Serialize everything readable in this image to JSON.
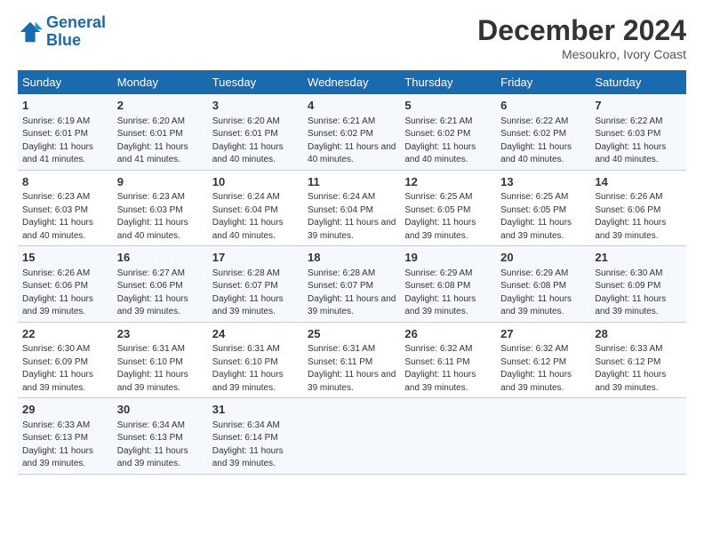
{
  "logo": {
    "line1": "General",
    "line2": "Blue"
  },
  "title": "December 2024",
  "subtitle": "Mesoukro, Ivory Coast",
  "days_of_week": [
    "Sunday",
    "Monday",
    "Tuesday",
    "Wednesday",
    "Thursday",
    "Friday",
    "Saturday"
  ],
  "weeks": [
    [
      {
        "num": "1",
        "rise": "6:19 AM",
        "set": "6:01 PM",
        "daylight": "11 hours and 41 minutes."
      },
      {
        "num": "2",
        "rise": "6:20 AM",
        "set": "6:01 PM",
        "daylight": "11 hours and 41 minutes."
      },
      {
        "num": "3",
        "rise": "6:20 AM",
        "set": "6:01 PM",
        "daylight": "11 hours and 40 minutes."
      },
      {
        "num": "4",
        "rise": "6:21 AM",
        "set": "6:02 PM",
        "daylight": "11 hours and 40 minutes."
      },
      {
        "num": "5",
        "rise": "6:21 AM",
        "set": "6:02 PM",
        "daylight": "11 hours and 40 minutes."
      },
      {
        "num": "6",
        "rise": "6:22 AM",
        "set": "6:02 PM",
        "daylight": "11 hours and 40 minutes."
      },
      {
        "num": "7",
        "rise": "6:22 AM",
        "set": "6:03 PM",
        "daylight": "11 hours and 40 minutes."
      }
    ],
    [
      {
        "num": "8",
        "rise": "6:23 AM",
        "set": "6:03 PM",
        "daylight": "11 hours and 40 minutes."
      },
      {
        "num": "9",
        "rise": "6:23 AM",
        "set": "6:03 PM",
        "daylight": "11 hours and 40 minutes."
      },
      {
        "num": "10",
        "rise": "6:24 AM",
        "set": "6:04 PM",
        "daylight": "11 hours and 40 minutes."
      },
      {
        "num": "11",
        "rise": "6:24 AM",
        "set": "6:04 PM",
        "daylight": "11 hours and 39 minutes."
      },
      {
        "num": "12",
        "rise": "6:25 AM",
        "set": "6:05 PM",
        "daylight": "11 hours and 39 minutes."
      },
      {
        "num": "13",
        "rise": "6:25 AM",
        "set": "6:05 PM",
        "daylight": "11 hours and 39 minutes."
      },
      {
        "num": "14",
        "rise": "6:26 AM",
        "set": "6:06 PM",
        "daylight": "11 hours and 39 minutes."
      }
    ],
    [
      {
        "num": "15",
        "rise": "6:26 AM",
        "set": "6:06 PM",
        "daylight": "11 hours and 39 minutes."
      },
      {
        "num": "16",
        "rise": "6:27 AM",
        "set": "6:06 PM",
        "daylight": "11 hours and 39 minutes."
      },
      {
        "num": "17",
        "rise": "6:28 AM",
        "set": "6:07 PM",
        "daylight": "11 hours and 39 minutes."
      },
      {
        "num": "18",
        "rise": "6:28 AM",
        "set": "6:07 PM",
        "daylight": "11 hours and 39 minutes."
      },
      {
        "num": "19",
        "rise": "6:29 AM",
        "set": "6:08 PM",
        "daylight": "11 hours and 39 minutes."
      },
      {
        "num": "20",
        "rise": "6:29 AM",
        "set": "6:08 PM",
        "daylight": "11 hours and 39 minutes."
      },
      {
        "num": "21",
        "rise": "6:30 AM",
        "set": "6:09 PM",
        "daylight": "11 hours and 39 minutes."
      }
    ],
    [
      {
        "num": "22",
        "rise": "6:30 AM",
        "set": "6:09 PM",
        "daylight": "11 hours and 39 minutes."
      },
      {
        "num": "23",
        "rise": "6:31 AM",
        "set": "6:10 PM",
        "daylight": "11 hours and 39 minutes."
      },
      {
        "num": "24",
        "rise": "6:31 AM",
        "set": "6:10 PM",
        "daylight": "11 hours and 39 minutes."
      },
      {
        "num": "25",
        "rise": "6:31 AM",
        "set": "6:11 PM",
        "daylight": "11 hours and 39 minutes."
      },
      {
        "num": "26",
        "rise": "6:32 AM",
        "set": "6:11 PM",
        "daylight": "11 hours and 39 minutes."
      },
      {
        "num": "27",
        "rise": "6:32 AM",
        "set": "6:12 PM",
        "daylight": "11 hours and 39 minutes."
      },
      {
        "num": "28",
        "rise": "6:33 AM",
        "set": "6:12 PM",
        "daylight": "11 hours and 39 minutes."
      }
    ],
    [
      {
        "num": "29",
        "rise": "6:33 AM",
        "set": "6:13 PM",
        "daylight": "11 hours and 39 minutes."
      },
      {
        "num": "30",
        "rise": "6:34 AM",
        "set": "6:13 PM",
        "daylight": "11 hours and 39 minutes."
      },
      {
        "num": "31",
        "rise": "6:34 AM",
        "set": "6:14 PM",
        "daylight": "11 hours and 39 minutes."
      },
      null,
      null,
      null,
      null
    ]
  ]
}
